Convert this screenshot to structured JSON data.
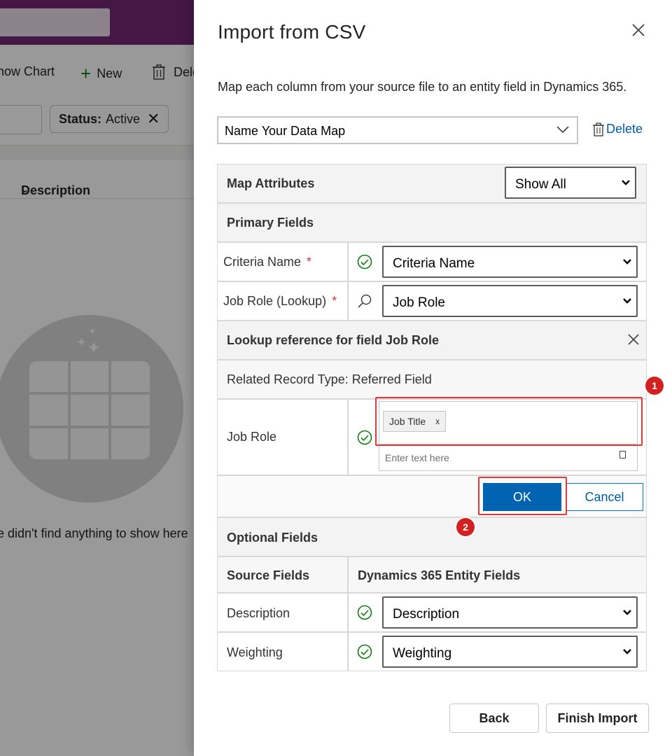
{
  "background": {
    "commands": {
      "show_chart": "how Chart",
      "new": "New",
      "delete": "Dele"
    },
    "filter_chip": {
      "key": "Status:",
      "value": "Active"
    },
    "column_header": "Description",
    "empty_message": "e didn't find anything to show here"
  },
  "panel": {
    "title": "Import from CSV",
    "description": "Map each column from your source file to an entity field in Dynamics 365.",
    "data_map": {
      "value": "Name Your Data Map"
    },
    "delete_label": "Delete",
    "map_attributes": {
      "label": "Map Attributes",
      "filter_value": "Show All"
    },
    "primary_fields": {
      "heading": "Primary Fields",
      "rows": [
        {
          "label": "Criteria Name",
          "required": "*",
          "value": "Criteria Name"
        },
        {
          "label": "Job Role (Lookup)",
          "required": "*",
          "value": "Job Role"
        }
      ]
    },
    "lookup": {
      "heading": "Lookup reference for field Job Role",
      "related": "Related Record Type: Referred Field",
      "field_label": "Job Role",
      "tag": "Job Title",
      "tag_remove": "x",
      "input_placeholder": "Enter text here",
      "ok": "OK",
      "cancel": "Cancel"
    },
    "optional_fields": {
      "heading": "Optional Fields",
      "source_header": "Source Fields",
      "target_header": "Dynamics 365 Entity Fields",
      "rows": [
        {
          "label": "Description",
          "value": "Description"
        },
        {
          "label": "Weighting",
          "value": "Weighting"
        }
      ]
    },
    "footer": {
      "back": "Back",
      "finish": "Finish Import"
    }
  },
  "annotations": {
    "badge_1": "1",
    "badge_2": "2"
  },
  "colors": {
    "accent": "#0063b1",
    "success": "#107c10",
    "required": "#d13438",
    "highlight": "#e23a3a",
    "header_purple": "#742774"
  }
}
